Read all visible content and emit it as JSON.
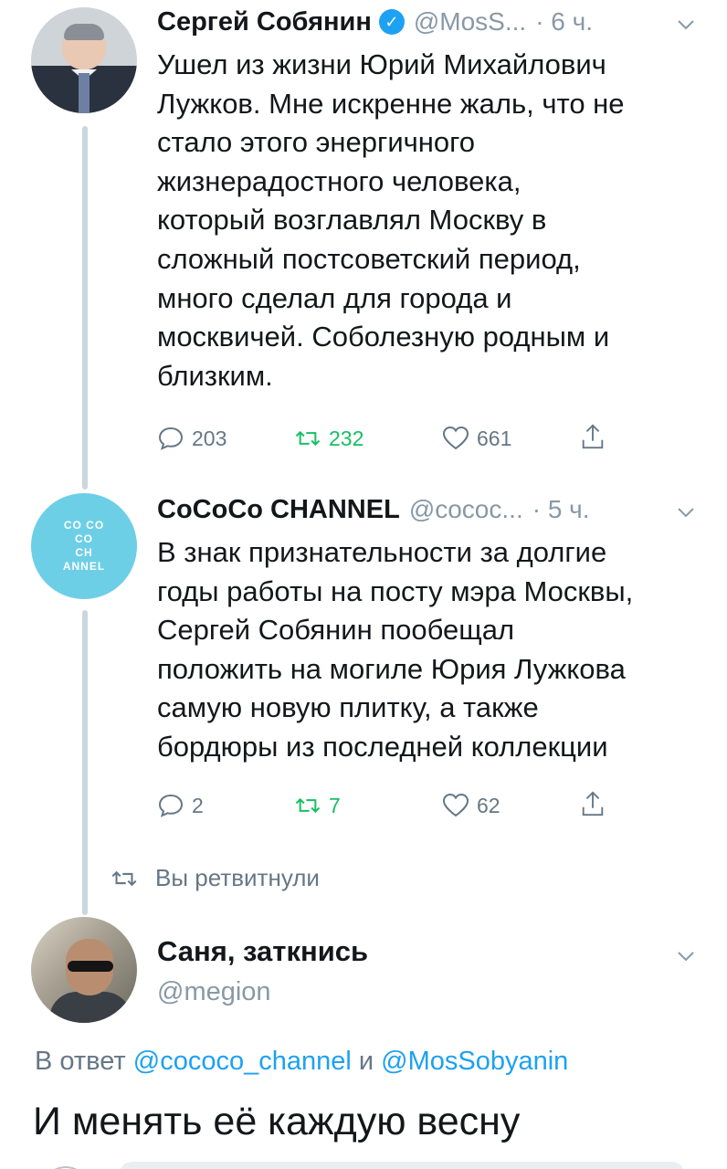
{
  "tweets": [
    {
      "name": "Сергей Собянин",
      "verified": true,
      "handle": "@MosS...",
      "time": "· 6 ч.",
      "text": "Ушел из жизни Юрий Михайлович\nЛужков. Мне искренне жаль, что не\nстало этого энергичного\nжизнерадостного человека,\nкоторый возглавлял Москву в\nсложный постсоветский период,\nмного сделал для города и\nмосквичей. Соболезную родным и\nблизким.",
      "replies": "203",
      "retweets": "232",
      "likes": "661"
    },
    {
      "name": "CoCoCo CHANNEL",
      "handle": "@cococ...",
      "time": "· 5 ч.",
      "avatar_logo_lines": [
        "CO CO",
        "CO",
        "CH",
        "ANNEL"
      ],
      "text": "В знак признательности за долгие\nгоды работы на посту мэра Москвы,\nСергей Собянин пообещал\nположить на могиле Юрия Лужкова\nсамую новую плитку, а также\nбордюры из последней коллекции",
      "replies": "2",
      "retweets": "7",
      "likes": "62"
    }
  ],
  "retweet_notice": "Вы ретвитнули",
  "reply": {
    "name": "Саня, заткнись",
    "handle": "@megion",
    "reply_to_prefix": "В ответ",
    "reply_to_user1": "@cococo_channel",
    "reply_to_joiner": "и",
    "reply_to_user2": "@MosSobyanin",
    "text": "И менять её каждую весну"
  },
  "icons": {
    "reply": "reply-icon",
    "retweet": "retweet-icon",
    "like": "heart-icon",
    "share": "share-icon",
    "verified": "verified-badge-icon",
    "menu": "chevron-down-icon"
  },
  "colors": {
    "accent": "#1da1f2",
    "retweet_active": "#17bf63",
    "secondary_text": "#657786",
    "cococo_avatar": "#6dcfe6"
  }
}
